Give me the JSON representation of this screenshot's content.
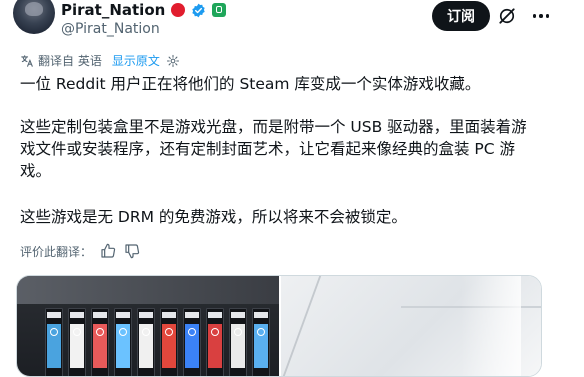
{
  "author": {
    "display_name": "Pirat_Nation",
    "handle": "@Pirat_Nation"
  },
  "actions": {
    "subscribe_label": "订阅"
  },
  "translation": {
    "translated_from": "翻译自 英语",
    "show_original": "显示原文"
  },
  "tweet": {
    "paragraphs": [
      "一位 Reddit 用户正在将他们的 Steam 库变成一个实体游戏收藏。",
      "这些定制包装盒里不是游戏光盘，而是附带一个 USB 驱动器，里面装着游戏文件或安装程序，还有定制封面艺术，让它看起来像经典的盒装 PC 游戏。",
      "这些游戏是无 DRM 的免费游戏，所以将来不会被锁定。"
    ]
  },
  "rating": {
    "label": "评价此翻译："
  },
  "media": {
    "box_colors": [
      "#4aa3df",
      "#f2f2f2",
      "#e85a5a",
      "#6bc2ff",
      "#f0f0f0",
      "#e2473c",
      "#3b82f6",
      "#d94040",
      "#eaeaea",
      "#5ab0f0"
    ]
  },
  "colors": {
    "accent": "#1d9bf0",
    "text": "#0f1419",
    "secondary": "#536471",
    "button_bg": "#0f1419"
  }
}
